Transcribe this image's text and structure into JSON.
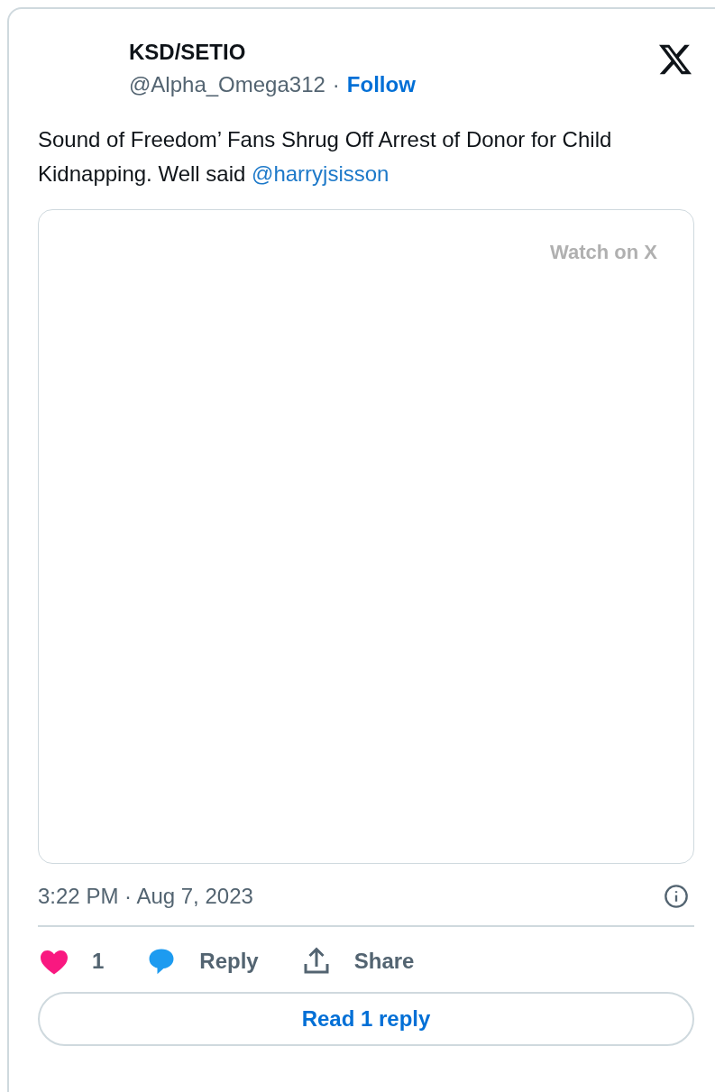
{
  "author": {
    "name": "KSD/SETIO",
    "handle": "@Alpha_Omega312",
    "separator": "·",
    "follow": "Follow"
  },
  "tweet": {
    "text": "Sound of Freedom’ Fans Shrug Off Arrest of Donor for Child Kidnapping. Well said ",
    "mention": "@harryjsisson"
  },
  "media": {
    "watch_label": "Watch on X"
  },
  "timestamp": "3:22 PM · Aug 7, 2023",
  "actions": [
    {
      "kind": "like",
      "label": "1"
    },
    {
      "kind": "reply",
      "label": "Reply"
    },
    {
      "kind": "share",
      "label": "Share"
    }
  ],
  "read_replies": "Read 1 reply"
}
